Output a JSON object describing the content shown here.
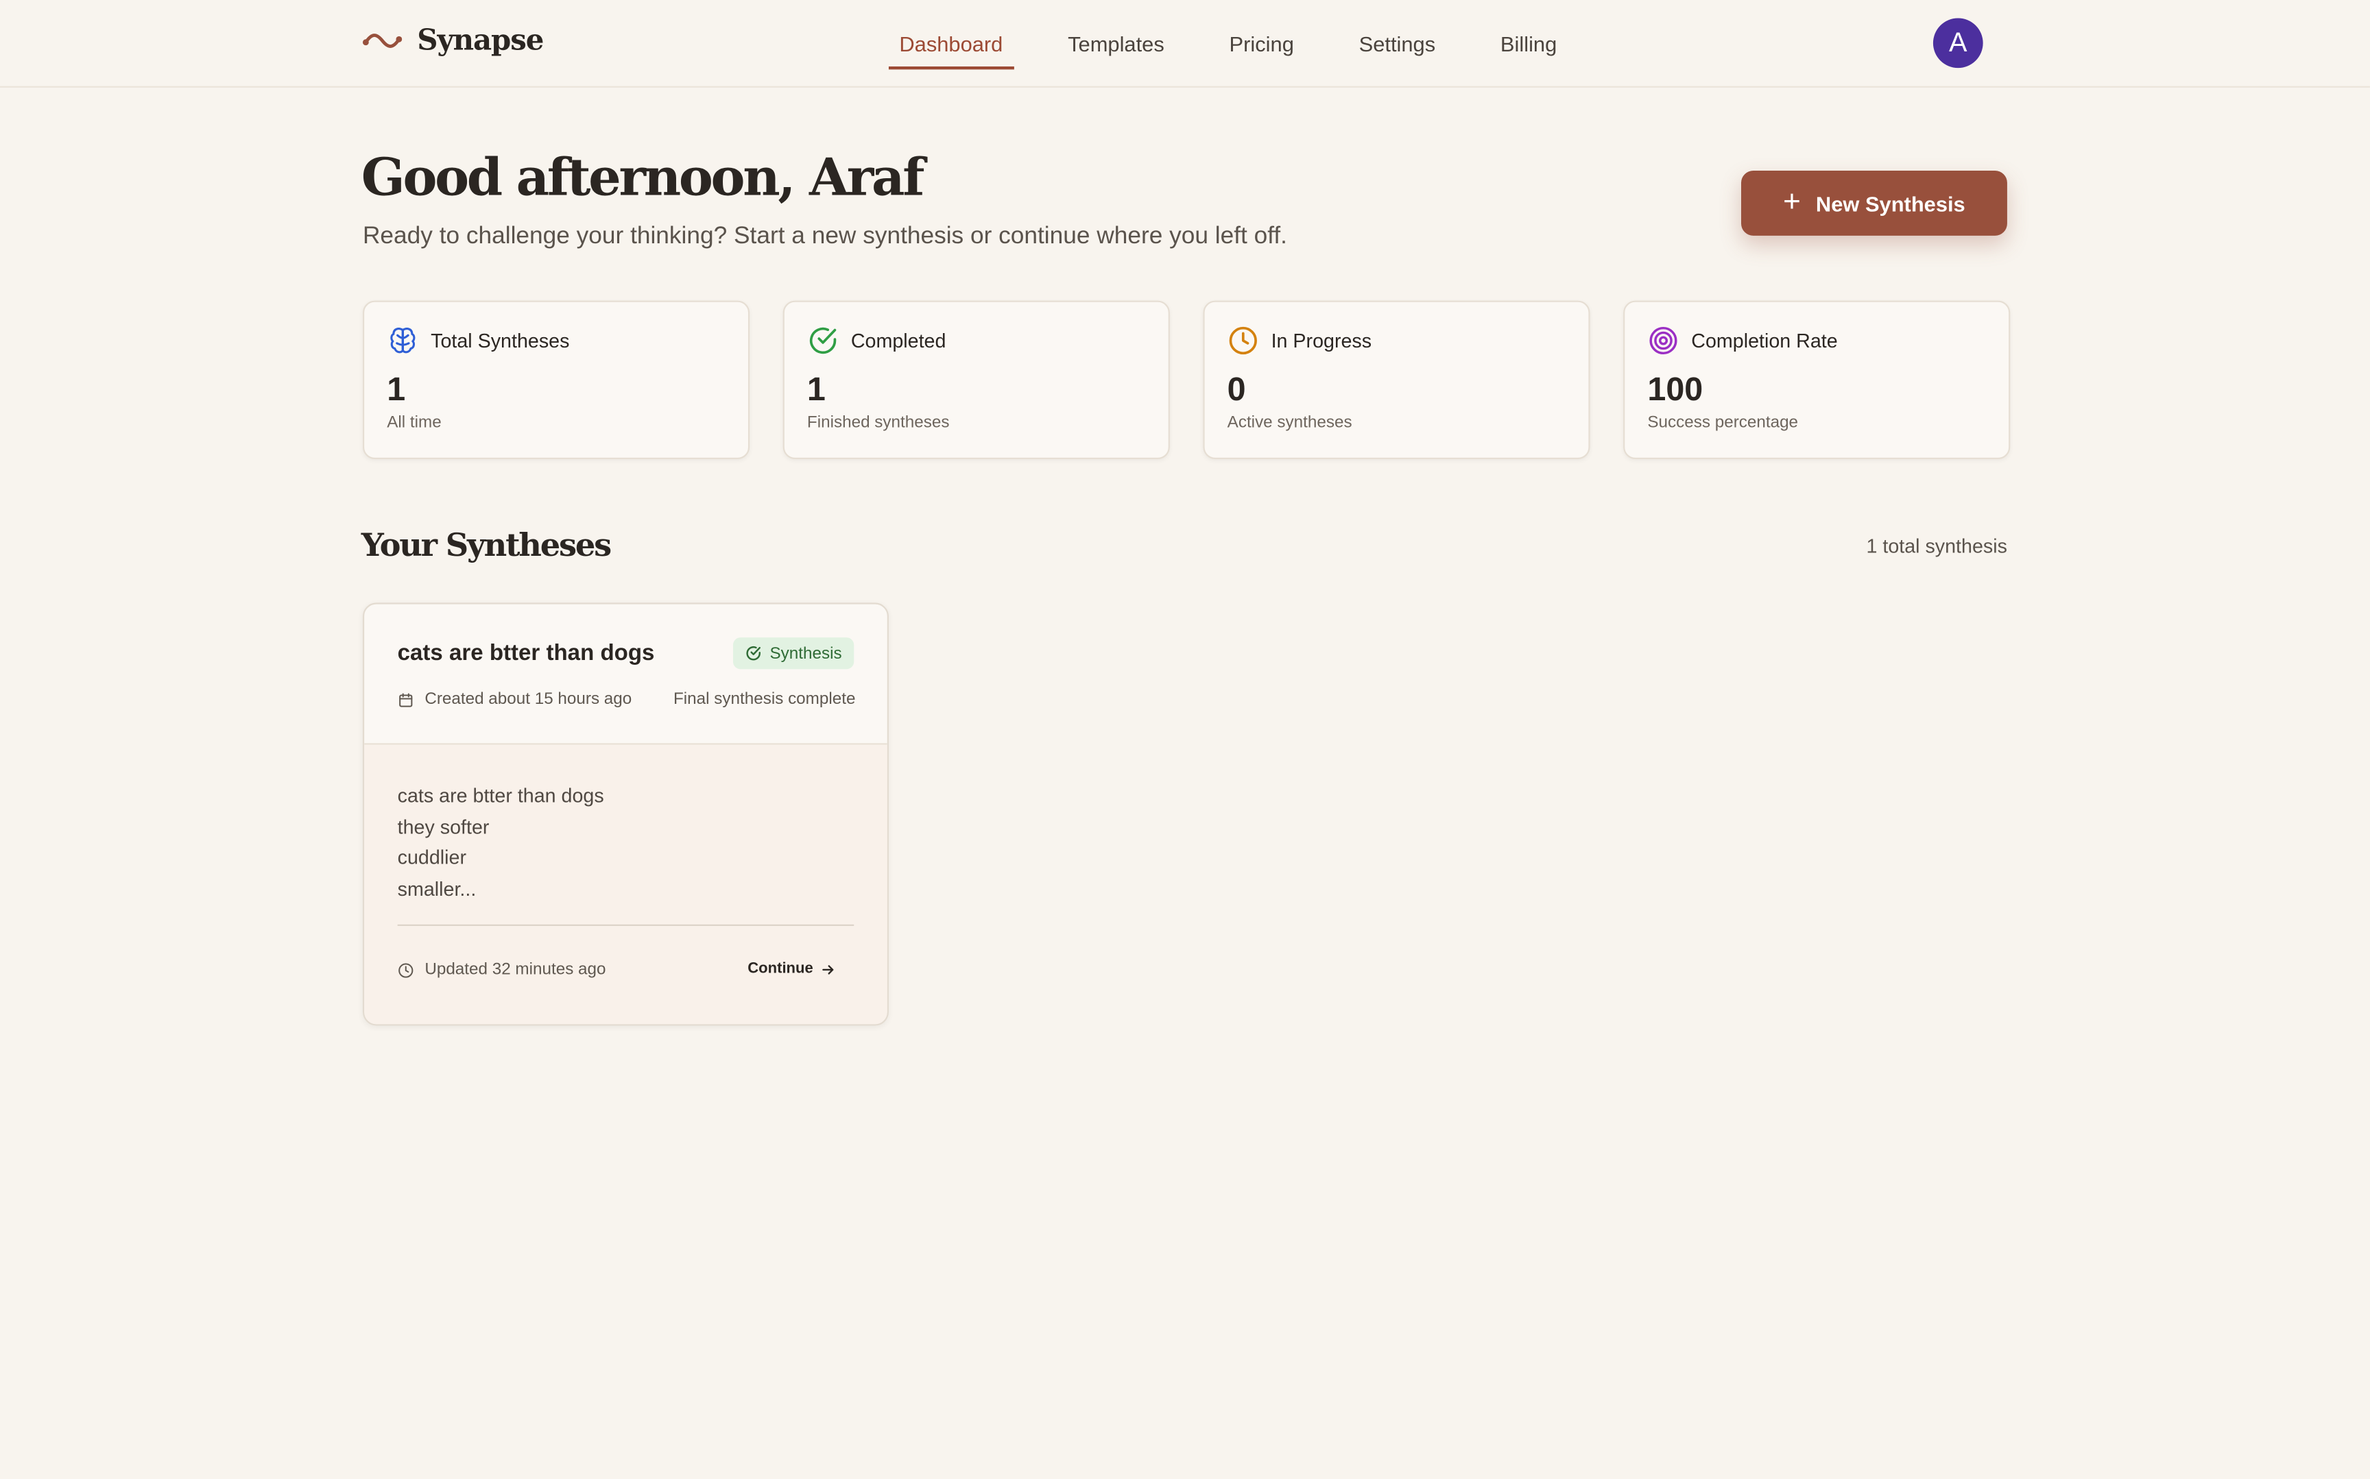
{
  "app": {
    "name": "Synapse"
  },
  "nav": {
    "items": [
      {
        "label": "Dashboard",
        "active": true
      },
      {
        "label": "Templates",
        "active": false
      },
      {
        "label": "Pricing",
        "active": false
      },
      {
        "label": "Settings",
        "active": false
      },
      {
        "label": "Billing",
        "active": false
      }
    ]
  },
  "user": {
    "avatar_initial": "A",
    "avatar_color": "#4c2f9e"
  },
  "hero": {
    "greeting": "Good afternoon, Araf",
    "subtitle": "Ready to challenge your thinking? Start a new synthesis or continue where you left off.",
    "new_button": "New Synthesis"
  },
  "stats": [
    {
      "label": "Total Syntheses",
      "value": "1",
      "caption": "All time",
      "icon": "brain-icon",
      "color": "#2f5fd6"
    },
    {
      "label": "Completed",
      "value": "1",
      "caption": "Finished syntheses",
      "icon": "check-circle-icon",
      "color": "#2f9e44"
    },
    {
      "label": "In Progress",
      "value": "0",
      "caption": "Active syntheses",
      "icon": "clock-icon",
      "color": "#d4820f"
    },
    {
      "label": "Completion Rate",
      "value": "100",
      "caption": "Success percentage",
      "icon": "target-icon",
      "color": "#9b2fc4"
    }
  ],
  "section": {
    "title": "Your Syntheses",
    "count": "1 total synthesis"
  },
  "syntheses": [
    {
      "title": "cats are btter than dogs",
      "badge": "Synthesis",
      "created": "Created about 15 hours ago",
      "status": "Final synthesis complete",
      "preview": [
        "cats are btter than dogs",
        "they softer",
        "cuddlier",
        "smaller..."
      ],
      "updated": "Updated 32 minutes ago",
      "continue": "Continue"
    }
  ],
  "colors": {
    "accent": "#98503c",
    "background": "#f8f4ee"
  }
}
